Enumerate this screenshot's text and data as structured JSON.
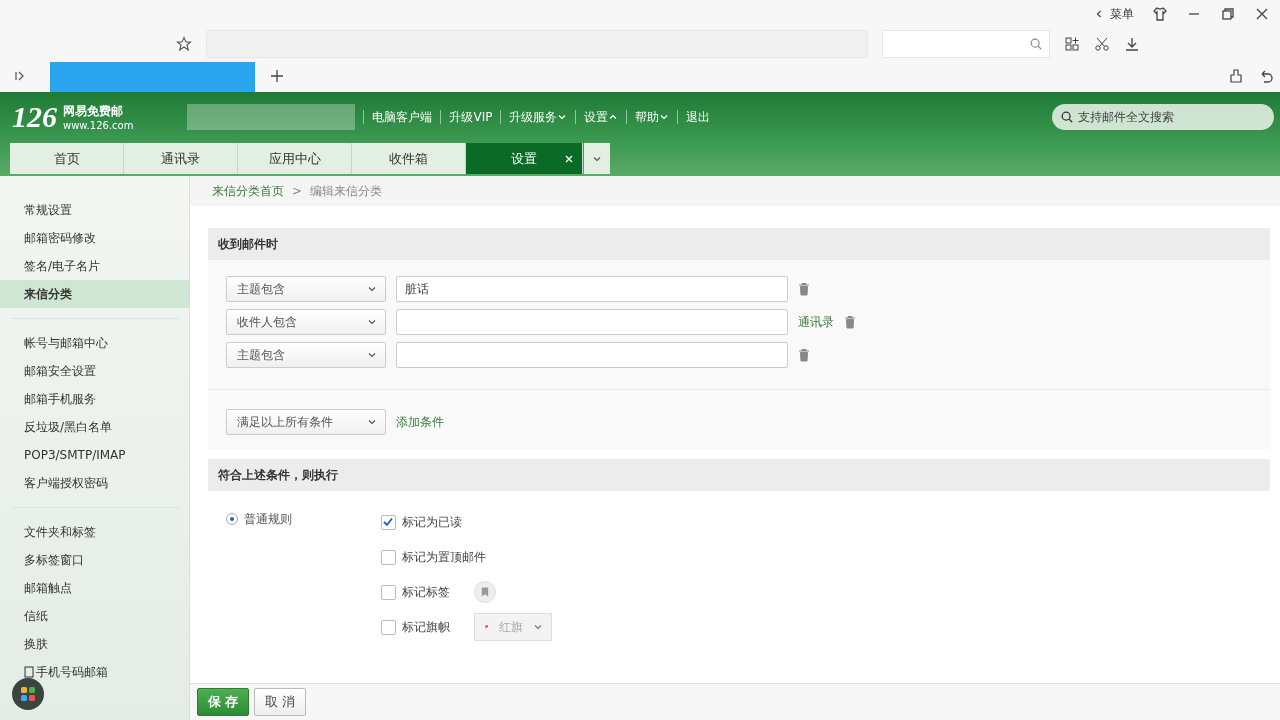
{
  "browser": {
    "menu_label": "菜单"
  },
  "header": {
    "logo": "126",
    "brand": "网易免费邮",
    "domain": "www.126.com",
    "nav": [
      {
        "label": "电脑客户端",
        "has_menu": false
      },
      {
        "label": "升级VIP",
        "has_menu": false
      },
      {
        "label": "升级服务",
        "has_menu": true,
        "expanded": false
      },
      {
        "label": "设置",
        "has_menu": true,
        "expanded": true
      },
      {
        "label": "帮助",
        "has_menu": true,
        "expanded": false
      },
      {
        "label": "退出",
        "has_menu": false
      }
    ],
    "search": {
      "placeholder": "支持邮件全文搜索"
    }
  },
  "tabs": [
    {
      "label": "首页",
      "selected": false,
      "closable": false
    },
    {
      "label": "通讯录",
      "selected": false,
      "closable": false
    },
    {
      "label": "应用中心",
      "selected": false,
      "closable": false
    },
    {
      "label": "收件箱",
      "selected": false,
      "closable": false
    },
    {
      "label": "设置",
      "selected": true,
      "closable": true
    }
  ],
  "sidebar": {
    "groups": [
      {
        "items": [
          {
            "label": "常规设置",
            "selected": false
          },
          {
            "label": "邮箱密码修改",
            "selected": false
          },
          {
            "label": "签名/电子名片",
            "selected": false
          },
          {
            "label": "来信分类",
            "selected": true
          }
        ]
      },
      {
        "items": [
          {
            "label": "帐号与邮箱中心",
            "selected": false
          },
          {
            "label": "邮箱安全设置",
            "selected": false
          },
          {
            "label": "邮箱手机服务",
            "selected": false
          },
          {
            "label": "反垃圾/黑白名单",
            "selected": false
          },
          {
            "label": "POP3/SMTP/IMAP",
            "selected": false
          },
          {
            "label": "客户端授权密码",
            "selected": false
          }
        ]
      },
      {
        "items": [
          {
            "label": "文件夹和标签",
            "selected": false
          },
          {
            "label": "多标签窗口",
            "selected": false
          },
          {
            "label": "邮箱触点",
            "selected": false
          },
          {
            "label": "信纸",
            "selected": false
          },
          {
            "label": "换肤",
            "selected": false
          },
          {
            "label": "手机号码邮箱",
            "selected": false,
            "kind": "phone"
          }
        ]
      }
    ]
  },
  "breadcrumb": [
    {
      "label": "来信分类首页",
      "kind": "link"
    },
    {
      "label": ">",
      "kind": "separator"
    },
    {
      "label": "编辑来信分类",
      "kind": "current"
    }
  ],
  "conditions_section": {
    "title": "收到邮件时",
    "conditions": [
      {
        "field": "主题包含",
        "value": "脏话",
        "contacts_link": false
      },
      {
        "field": "收件人包含",
        "contacts_link": true,
        "link_label": "通讯录"
      },
      {
        "field": "主题包含",
        "contacts_link": false
      }
    ],
    "match": "满足以上所有条件",
    "add_link": "添加条件"
  },
  "actions_section": {
    "title": "符合上述条件，则执行",
    "rule": {
      "label": "普通规则",
      "selected": true
    },
    "actions": [
      {
        "label": "标记为已读",
        "checked": true,
        "kind": "plain"
      },
      {
        "label": "标记为置顶邮件",
        "checked": false,
        "kind": "plain"
      },
      {
        "label": "标记标签",
        "checked": false,
        "kind": "tag"
      },
      {
        "label": "标记旗帜",
        "checked": false,
        "kind": "flag",
        "flag_label": "红旗"
      }
    ]
  },
  "buttons": [
    {
      "label": "保 存",
      "kind": "primary"
    },
    {
      "label": "取 消",
      "kind": "secondary"
    }
  ]
}
